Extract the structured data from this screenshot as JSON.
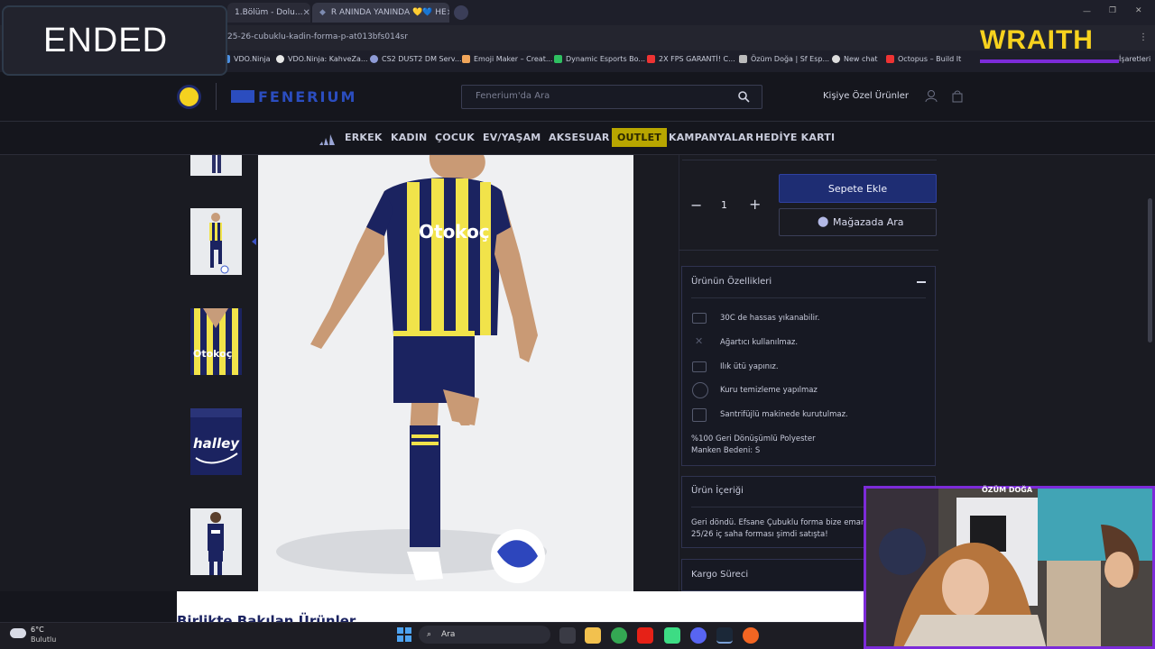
{
  "browser": {
    "tabs": [
      {
        "label": "1.Bölüm - Dolu..."
      },
      {
        "label": "R ANINDA YANINDA 💛💙 HE"
      }
    ],
    "url": "25-26-cubuklu-kadin-forma-p-at013bfs014sr",
    "bookmarks": [
      "VDO.Ninja",
      "VDO.Ninja: KahveZa...",
      "CS2 DUST2 DM Serv...",
      "Emoji Maker – Creat...",
      "Dynamic Esports Bo...",
      "2X FPS GARANTİ! C...",
      "Özüm Doğa | Sf Esp...",
      "New chat",
      "Octopus – Build It",
      "İşaretleri"
    ]
  },
  "overlay": {
    "ended": "ENDED",
    "brand": "WRAITH",
    "cam_title": "ÖZÜM DOĞA"
  },
  "site": {
    "search_placeholder": "Fenerium'da Ara",
    "personal_products": "Kişiye Özel Ürünler",
    "nav": [
      "ERKEK",
      "KADIN",
      "ÇOCUK",
      "EV/YAŞAM",
      "AKSESUAR",
      "OUTLET",
      "KAMPANYALAR",
      "HEDİYE KARTI"
    ]
  },
  "product": {
    "quantity": "1",
    "add_to_cart": "Sepete Ekle",
    "find_in_store": "Mağazada Ara",
    "features_title": "Ürünün Özellikleri",
    "care": [
      "30C de hassas yıkanabilir.",
      "Ağartıcı kullanılmaz.",
      "Ilık ütü yapınız.",
      "Kuru temizleme yapılmaz",
      "Santrifüjlü makinede kurutulmaz."
    ],
    "material": "%100 Geri Dönüşümlü Polyester",
    "model_size": "Manken Bedeni: S",
    "contents_title": "Ürün İçeriği",
    "contents_text_1": "Geri döndü. Efsane Çubuklu forma bize emanet!",
    "contents_text_2": "25/26 iç saha forması şimdi satışta!",
    "shipping_title": "Kargo Süreci",
    "related_title": "Birlikte Bakılan Ürünler",
    "jersey_sponsor": "Otokoç",
    "back_sponsor": "halley"
  },
  "taskbar": {
    "weather_temp": "6°C",
    "weather_desc": "Bulutlu",
    "search": "Ara"
  }
}
